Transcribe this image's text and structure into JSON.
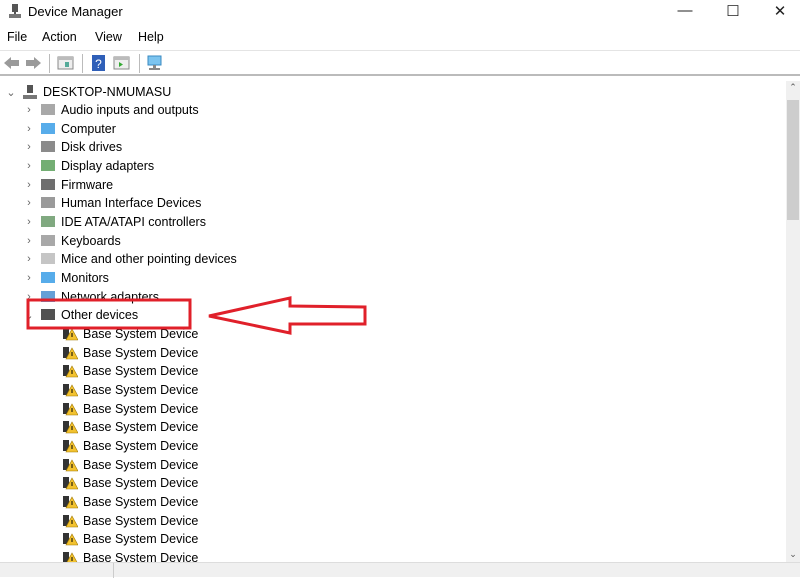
{
  "window": {
    "title": "Device Manager",
    "minimize": "—",
    "maximize": "☐",
    "close": "✕"
  },
  "menu": [
    "File",
    "Action",
    "View",
    "Help"
  ],
  "tree": {
    "root": "DESKTOP-NMUMASU",
    "categories": [
      {
        "label": "Audio inputs and outputs",
        "icon": "speaker-icon"
      },
      {
        "label": "Computer",
        "icon": "computer-icon"
      },
      {
        "label": "Disk drives",
        "icon": "disk-icon"
      },
      {
        "label": "Display adapters",
        "icon": "display-adapter-icon"
      },
      {
        "label": "Firmware",
        "icon": "firmware-icon"
      },
      {
        "label": "Human Interface Devices",
        "icon": "hid-icon"
      },
      {
        "label": "IDE ATA/ATAPI controllers",
        "icon": "ide-icon"
      },
      {
        "label": "Keyboards",
        "icon": "keyboard-icon"
      },
      {
        "label": "Mice and other pointing devices",
        "icon": "mouse-icon"
      },
      {
        "label": "Monitors",
        "icon": "monitor-icon"
      },
      {
        "label": "Network adapters",
        "icon": "network-icon"
      },
      {
        "label": "Other devices",
        "icon": "unknown-device-icon",
        "expanded": true
      }
    ],
    "other_devices": [
      "Base System Device",
      "Base System Device",
      "Base System Device",
      "Base System Device",
      "Base System Device",
      "Base System Device",
      "Base System Device",
      "Base System Device",
      "Base System Device",
      "Base System Device",
      "Base System Device",
      "Base System Device",
      "Base System Device"
    ]
  },
  "annotation": {
    "color": "#e0202a",
    "target": "Other devices"
  }
}
